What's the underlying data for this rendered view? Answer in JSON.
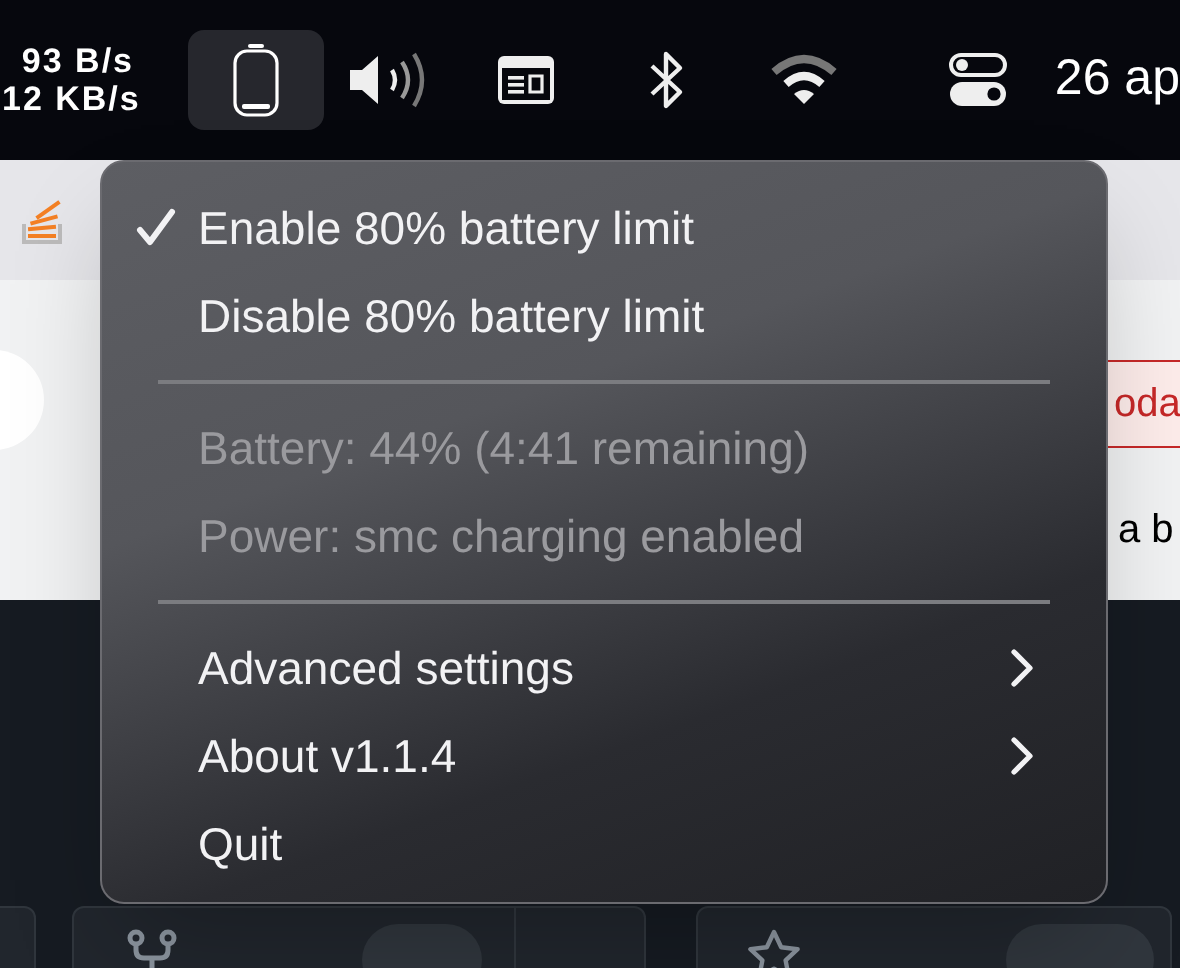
{
  "menu_bar": {
    "net_speed": [
      "93 B/s",
      "12 KB/s"
    ],
    "status_items": [
      {
        "kind": "battery",
        "selected": true
      },
      {
        "kind": "volume",
        "selected": false
      },
      {
        "kind": "window",
        "selected": false
      },
      {
        "kind": "bluetooth",
        "selected": false
      },
      {
        "kind": "wifi",
        "selected": false
      },
      {
        "kind": "controls",
        "selected": false
      }
    ],
    "clock": "26 ap"
  },
  "background": {
    "notice": "oda",
    "text": "a b"
  },
  "menu": {
    "items": [
      {
        "kind": "item",
        "label": "Enable 80% battery limit",
        "checked": true,
        "disabled": false,
        "submenu": false
      },
      {
        "kind": "item",
        "label": "Disable 80% battery limit",
        "checked": false,
        "disabled": false,
        "submenu": false
      },
      {
        "kind": "separator"
      },
      {
        "kind": "item",
        "label": "Battery: 44% (4:41 remaining)",
        "checked": false,
        "disabled": true,
        "submenu": false
      },
      {
        "kind": "item",
        "label": "Power: smc charging enabled",
        "checked": false,
        "disabled": true,
        "submenu": false
      },
      {
        "kind": "separator"
      },
      {
        "kind": "item",
        "label": "Advanced settings",
        "checked": false,
        "disabled": false,
        "submenu": true
      },
      {
        "kind": "item",
        "label": "About v1.1.4",
        "checked": false,
        "disabled": false,
        "submenu": true
      },
      {
        "kind": "item",
        "label": "Quit",
        "checked": false,
        "disabled": false,
        "submenu": false
      }
    ]
  }
}
